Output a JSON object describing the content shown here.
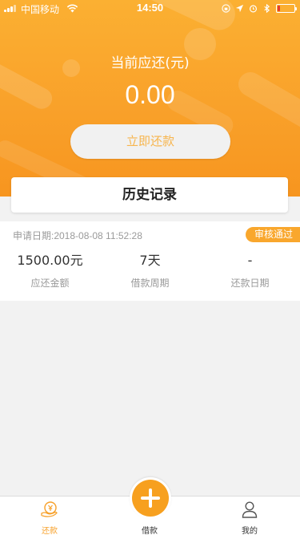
{
  "status_bar": {
    "carrier": "中国移动",
    "time": "14:50",
    "battery_level": 0.15,
    "icons": [
      "signal-icon",
      "wifi-icon",
      "lock-rotation-icon",
      "location-icon",
      "alarm-icon",
      "bluetooth-icon",
      "battery-icon"
    ]
  },
  "header": {
    "title": "当前应还(元)",
    "amount": "0.00",
    "repay_button_label": "立即还款"
  },
  "history": {
    "title": "历史记录"
  },
  "record": {
    "apply_date": "申请日期:2018-08-08 11:52:28",
    "status": "审核通过",
    "amount_value": "1500.00元",
    "amount_label": "应还金额",
    "period_value": "7天",
    "period_label": "借款周期",
    "repay_date_value": "-",
    "repay_date_label": "还款日期"
  },
  "tab_bar": {
    "tabs": [
      {
        "label": "还款",
        "icon": "repay-icon",
        "active": true
      },
      {
        "label": "借款",
        "icon": "plus-icon",
        "active": false
      },
      {
        "label": "我的",
        "icon": "user-icon",
        "active": false
      }
    ]
  },
  "colors": {
    "accent": "#f7a01f",
    "header_top": "#fbb032",
    "badge": "#f9a72d",
    "background": "#f2f2f2"
  }
}
